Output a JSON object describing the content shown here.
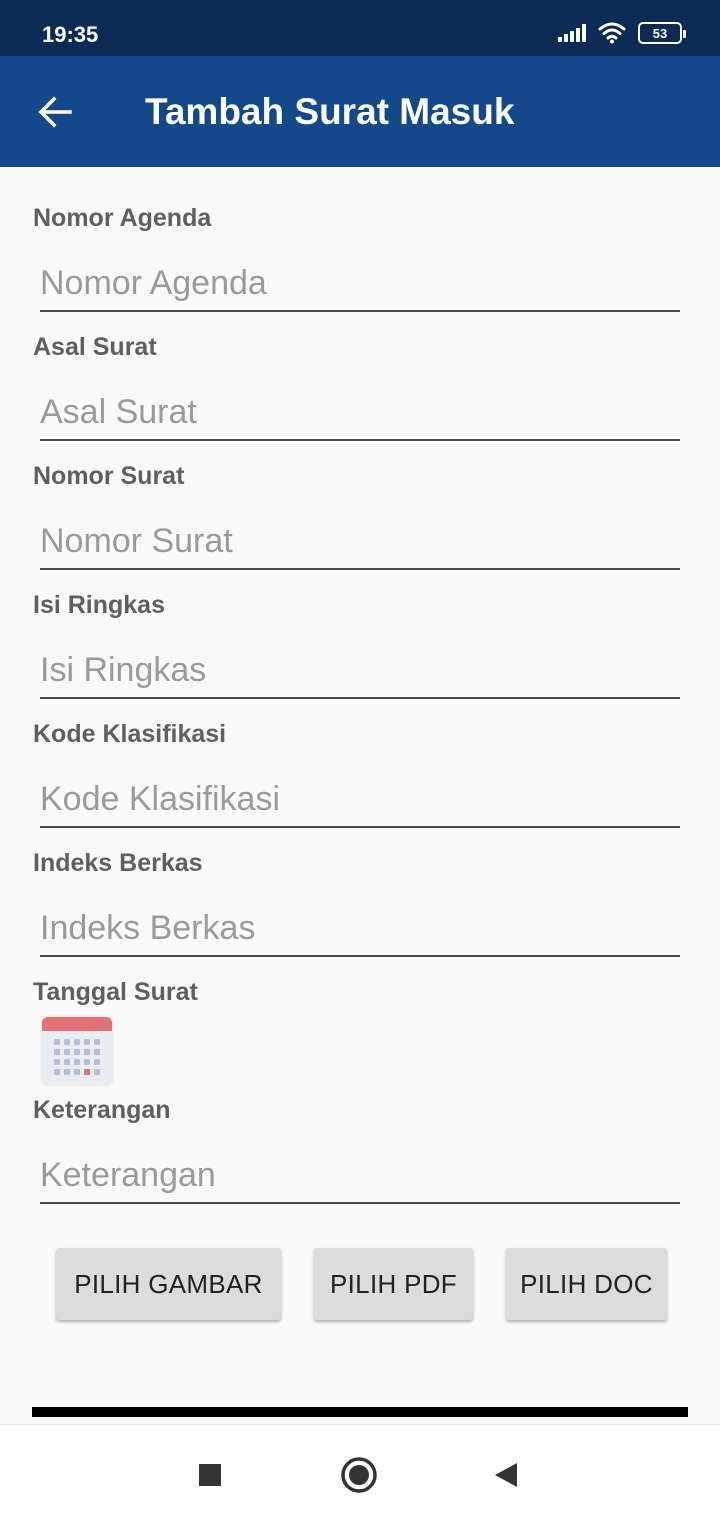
{
  "status_bar": {
    "time": "19:35",
    "battery": "53",
    "icons": [
      "signal-icon",
      "wifi-icon",
      "battery-icon"
    ]
  },
  "app_bar": {
    "title": "Tambah Surat Masuk",
    "back_icon": "arrow-back-icon",
    "background": "#13498a"
  },
  "form": {
    "fields": [
      {
        "label": "Nomor Agenda",
        "placeholder": "Nomor Agenda",
        "value": ""
      },
      {
        "label": "Asal Surat",
        "placeholder": "Asal Surat",
        "value": ""
      },
      {
        "label": "Nomor Surat",
        "placeholder": "Nomor Surat",
        "value": ""
      },
      {
        "label": "Isi Ringkas",
        "placeholder": "Isi Ringkas",
        "value": ""
      },
      {
        "label": "Kode Klasifikasi",
        "placeholder": "Kode Klasifikasi",
        "value": ""
      },
      {
        "label": "Indeks Berkas",
        "placeholder": "Indeks Berkas",
        "value": ""
      }
    ],
    "date_field": {
      "label": "Tanggal Surat",
      "icon": "calendar-icon"
    },
    "note_field": {
      "label": "Keterangan",
      "placeholder": "Keterangan",
      "value": ""
    }
  },
  "buttons": {
    "pick_image": "PILIH GAMBAR",
    "pick_pdf": "PILIH PDF",
    "pick_doc": "PILIH DOC"
  },
  "nav_bar": {
    "icons": [
      "recent-apps-icon",
      "home-icon",
      "back-triangle-icon"
    ]
  }
}
